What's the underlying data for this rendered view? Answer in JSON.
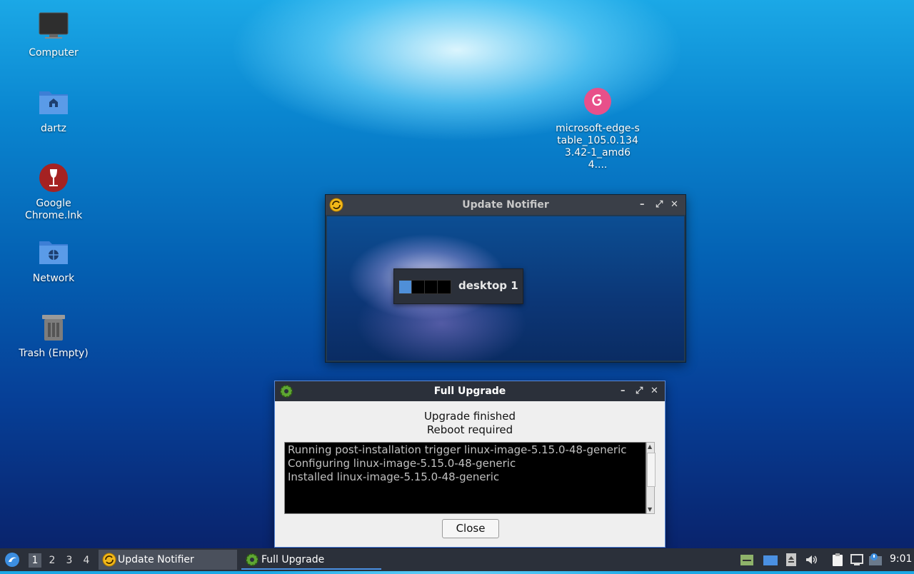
{
  "desktop": {
    "icons": [
      {
        "label": "Computer"
      },
      {
        "label": "dartz"
      },
      {
        "label": "Google Chrome.lnk"
      },
      {
        "label": "Network"
      },
      {
        "label": "Trash (Empty)"
      },
      {
        "label": "microsoft-edge-stable_105.0.1343.42-1_amd64...."
      }
    ]
  },
  "notifier_window": {
    "title": "Update Notifier",
    "pager_label": "desktop 1"
  },
  "upgrade_window": {
    "title": "Full Upgrade",
    "status_line1": "Upgrade finished",
    "status_line2": "Reboot required",
    "log_lines": [
      "Running post-installation trigger linux-image-5.15.0-48-generic",
      "Configuring linux-image-5.15.0-48-generic",
      "Installed linux-image-5.15.0-48-generic"
    ],
    "close_label": "Close"
  },
  "taskbar": {
    "workspaces": [
      "1",
      "2",
      "3",
      "4"
    ],
    "active_workspace": "1",
    "tasks": [
      {
        "label": "Update Notifier"
      },
      {
        "label": "Full Upgrade"
      }
    ],
    "clock": "9:01"
  }
}
